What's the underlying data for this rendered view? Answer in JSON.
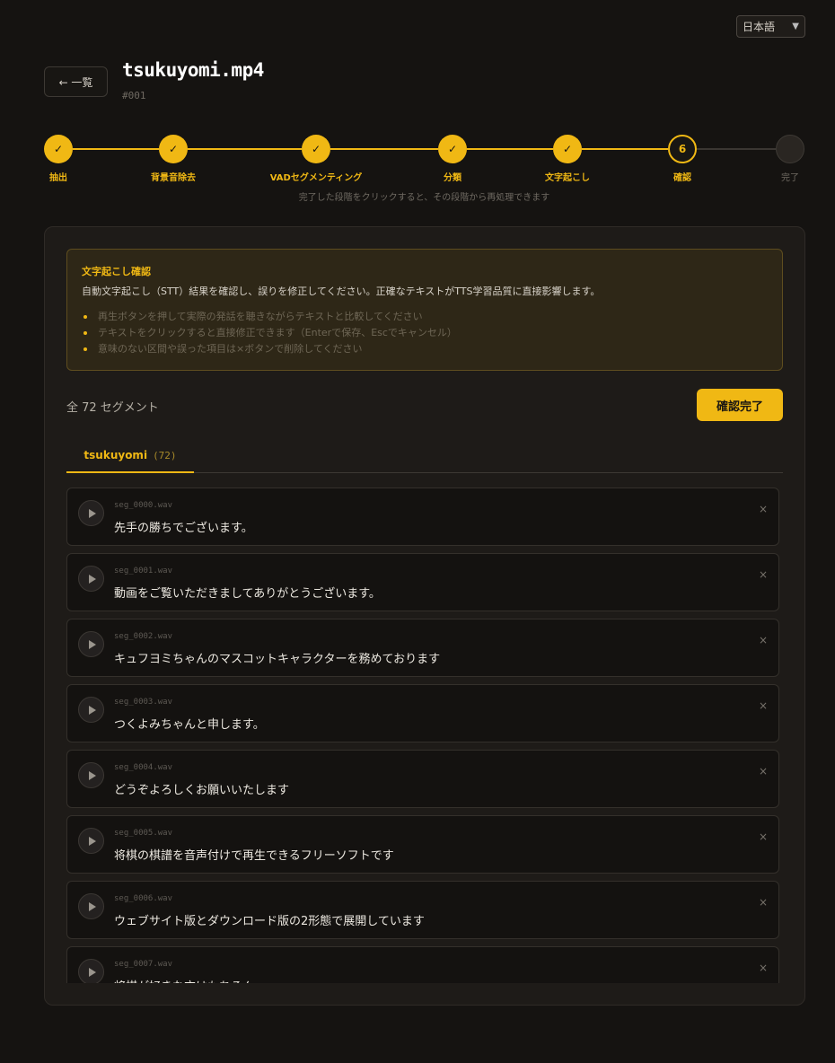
{
  "language": {
    "selected": "日本語"
  },
  "header": {
    "back_label": "← 一覧",
    "title": "tsukuyomi.mp4",
    "id": "#001"
  },
  "stepper": {
    "steps": [
      {
        "label": "抽出",
        "state": "done",
        "mark": "✓"
      },
      {
        "label": "背景音除去",
        "state": "done",
        "mark": "✓"
      },
      {
        "label": "VADセグメンティング",
        "state": "done",
        "mark": "✓"
      },
      {
        "label": "分類",
        "state": "done",
        "mark": "✓"
      },
      {
        "label": "文字起こし",
        "state": "done",
        "mark": "✓"
      },
      {
        "label": "確認",
        "state": "current",
        "mark": "6"
      },
      {
        "label": "完了",
        "state": "pending",
        "mark": ""
      }
    ],
    "hint": "完了した段階をクリックすると、その段階から再処理できます"
  },
  "info": {
    "title": "文字起こし確認",
    "description": "自動文字起こし（STT）結果を確認し、誤りを修正してください。正確なテキストがTTS学習品質に直接影響します。",
    "tips": [
      "再生ボタンを押して実際の発話を聴きながらテキストと比較してください",
      "テキストをクリックすると直接修正できます（Enterで保存、Escでキャンセル）",
      "意味のない区間や誤った項目は×ボタンで削除してください"
    ]
  },
  "summary": {
    "count_label": "全 72 セグメント",
    "confirm_label": "確認完了"
  },
  "tab": {
    "name": "tsukuyomi",
    "count": "(72)"
  },
  "segments": [
    {
      "file": "seg_0000.wav",
      "text": "先手の勝ちでございます。"
    },
    {
      "file": "seg_0001.wav",
      "text": "動画をご覧いただきましてありがとうございます。"
    },
    {
      "file": "seg_0002.wav",
      "text": "キュフヨミちゃんのマスコットキャラクターを務めております"
    },
    {
      "file": "seg_0003.wav",
      "text": "つくよみちゃんと申します。"
    },
    {
      "file": "seg_0004.wav",
      "text": "どうぞよろしくお願いいたします"
    },
    {
      "file": "seg_0005.wav",
      "text": "将棋の棋譜を音声付けで再生できるフリーソフトです"
    },
    {
      "file": "seg_0006.wav",
      "text": "ウェブサイト版とダウンロード版の2形態で展開しています"
    },
    {
      "file": "seg_0007.wav",
      "text": "将棋が好きな方はもちろん"
    }
  ],
  "delete_glyph": "×",
  "colors": {
    "accent": "#f0b814",
    "background": "#151311",
    "panel": "#1e1b18"
  }
}
